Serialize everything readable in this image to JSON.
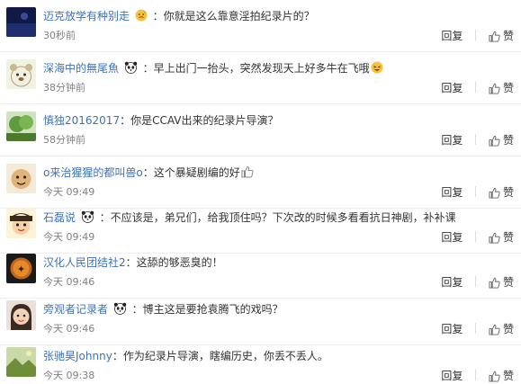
{
  "comments": [
    {
      "user": "迈克放学有种别走",
      "has_badge": true,
      "badge_icon": "sweat-emoji-icon",
      "text": "：你就是这么靠意淫拍纪录片的？",
      "time": "30秒前",
      "reply": "回复",
      "like": "赞",
      "avatar_icon": "dark-blue-avatar"
    },
    {
      "user": "深海中的無尾魚",
      "has_badge": true,
      "badge_icon": "panda-icon",
      "text": "：早上出门一抬头，突然发现天上好多牛在飞哦",
      "trail_icon": "laugh-emoji-icon",
      "time": "38分钟前",
      "reply": "回复",
      "like": "赞",
      "avatar_icon": "cartoon-bear-avatar"
    },
    {
      "user": "慎独20162017",
      "has_badge": false,
      "text": "：你是CCAV出来的纪录片导演？",
      "time": "58分钟前",
      "reply": "回复",
      "like": "赞",
      "avatar_icon": "green-tree-avatar"
    },
    {
      "user": "o来治猩猩的都叫兽o",
      "has_badge": false,
      "text": "：这个暴疑剧编的好",
      "trail_icon": "thumbs-up-icon",
      "time": "今天 09:49",
      "reply": "回复",
      "like": "赞",
      "avatar_icon": "cartoon-face-avatar"
    },
    {
      "user": "石磊说",
      "has_badge": true,
      "badge_icon": "panda-icon",
      "text": "：不应该是，弟兄们，给我顶住吗？下次改的时候多看看抗日神剧，补补课",
      "time": "今天 09:49",
      "reply": "回复",
      "like": "赞",
      "avatar_icon": "anime-boy-avatar"
    },
    {
      "user": "汉化人民团结社2",
      "has_badge": false,
      "text": "：这舔的够恶臭的！",
      "time": "今天 09:46",
      "reply": "回复",
      "like": "赞",
      "avatar_icon": "dark-seal-avatar"
    },
    {
      "user": "旁观者记录者",
      "has_badge": true,
      "badge_icon": "panda-icon",
      "text": "：博主这是要抢袁腾飞的戏吗？",
      "time": "今天 09:46",
      "reply": "回复",
      "like": "赞",
      "avatar_icon": "child-photo-avatar"
    },
    {
      "user": "张驰昊Johnny",
      "has_badge": false,
      "text": "：作为纪录片导演，瞎编历史，你丢不丢人。",
      "time": "今天 09:38",
      "reply": "回复",
      "like": "赞",
      "avatar_icon": "landscape-avatar"
    }
  ],
  "colors": {
    "username": "#3f71b7",
    "text": "#333333",
    "time": "#808080",
    "divider": "#eeeeee"
  }
}
